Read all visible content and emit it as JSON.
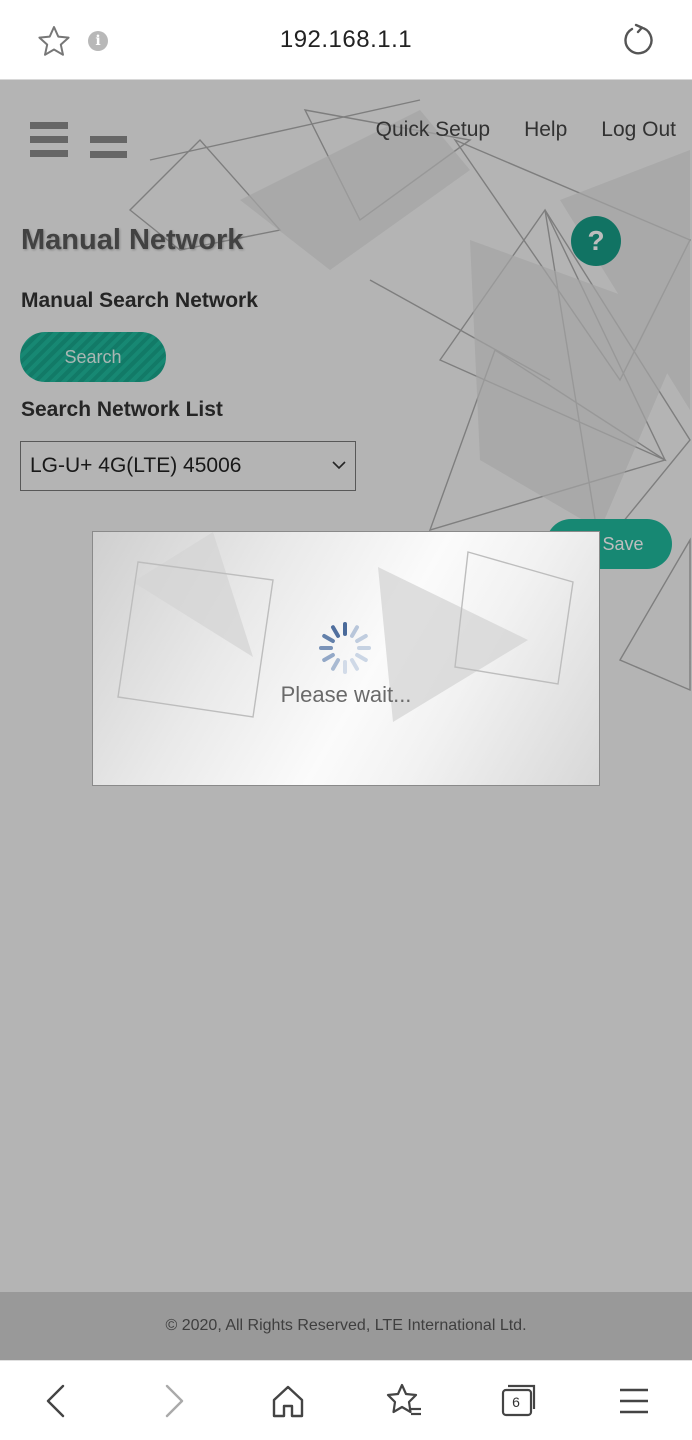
{
  "browser": {
    "url": "192.168.1.1",
    "tab_count": "6"
  },
  "nav": {
    "links": [
      "Quick Setup",
      "Help",
      "Log Out"
    ]
  },
  "page": {
    "title": "Manual Network",
    "help_symbol": "?",
    "manual_search_label": "Manual Search Network",
    "search_button": "Search",
    "network_list_label": "Search Network List",
    "selected_network": "LG-U+ 4G(LTE) 45006",
    "save_button": "Save"
  },
  "modal": {
    "message": "Please wait..."
  },
  "footer": {
    "text": "© 2020, All Rights Reserved, LTE International Ltd."
  },
  "colors": {
    "accent": "#1fb89c",
    "help_button": "#189c86"
  },
  "icons": {
    "bookmark": "star-icon",
    "info": "info-icon",
    "reload": "reload-icon",
    "back": "back-icon",
    "forward": "forward-icon",
    "home": "home-icon",
    "bookmarks": "bookmarks-icon",
    "tabs": "tabs-icon",
    "menu": "menu-icon"
  }
}
